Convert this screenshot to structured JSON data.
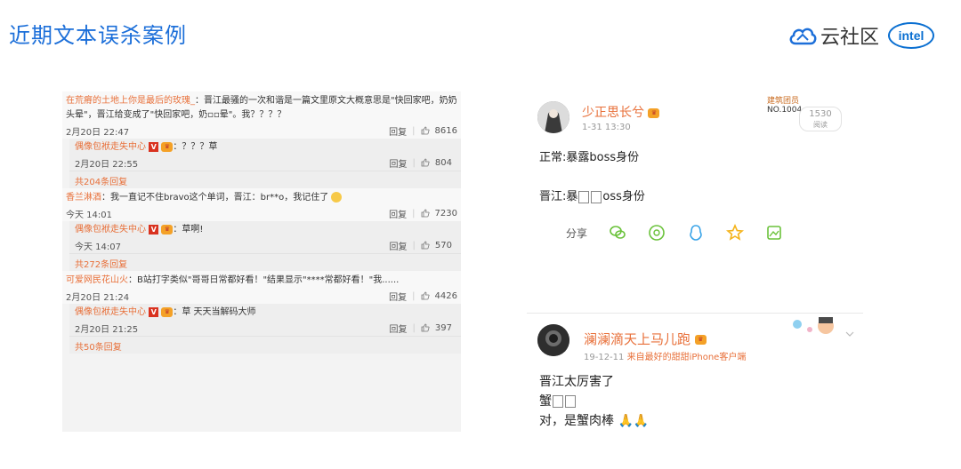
{
  "title": "近期文本误杀案例",
  "brand": {
    "text": "云社区",
    "intel": "intel"
  },
  "comments": [
    {
      "user": "在荒瘠的土地上你是最后的玫瑰_",
      "text": "：晋江最骚的一次和谐是一篇文里原文大概意思是\"快回家吧，奶奶头晕\"，晋江给变成了\"快回家吧，奶▫▫晕\"。我？？？？",
      "time": "2月20日 22:47",
      "reply": "回复",
      "likes": "8616",
      "sub": {
        "user": "偶像包袱走失中心",
        "vip": "V",
        "text": "：？？？草",
        "time": "2月20日 22:55",
        "reply": "回复",
        "likes": "804"
      },
      "more": "共204条回复"
    },
    {
      "user": "香兰淋酒",
      "text": "：我一直记不住bravo这个单词，晋江：br**o，我记住了",
      "time": "今天 14:01",
      "reply": "回复",
      "likes": "7230",
      "sub": {
        "user": "偶像包袱走失中心",
        "vip": "V",
        "text": "：草啊!",
        "time": "今天 14:07",
        "reply": "回复",
        "likes": "570"
      },
      "more": "共272条回复"
    },
    {
      "user": "可爱网民花山火",
      "text": "：B站打字类似\"哥哥日常都好看！\"结果显示\"****常都好看！\"我......",
      "time": "2月20日 21:24",
      "reply": "回复",
      "likes": "4426",
      "sub": {
        "user": "偶像包袱走失中心",
        "vip": "V",
        "text": "：草 天天当解码大师",
        "time": "2月20日 21:25",
        "reply": "回复",
        "likes": "397"
      },
      "more": "共50条回复"
    }
  ],
  "post1": {
    "name": "少正思长兮",
    "time": "1-31 13:30",
    "badge_title": "建筑团员",
    "badge_num": "NO.1004",
    "read_count": "1530",
    "read_label": "阅读",
    "line1": "正常:暴露boss身份",
    "line2_prefix": "晋江:暴",
    "line2_suffix": "oss身份",
    "share_label": "分享"
  },
  "post2": {
    "name": "澜澜滴天上马儿跑",
    "time": "19-12-11",
    "source": "来自最好的甜甜iPhone客户端",
    "line1": "晋江太厉害了",
    "line2": "蟹",
    "line3": "对，是蟹肉棒"
  },
  "colors": {
    "title": "#1c6fd9",
    "username": "#e8703a",
    "intel": "#0a6fd1"
  }
}
